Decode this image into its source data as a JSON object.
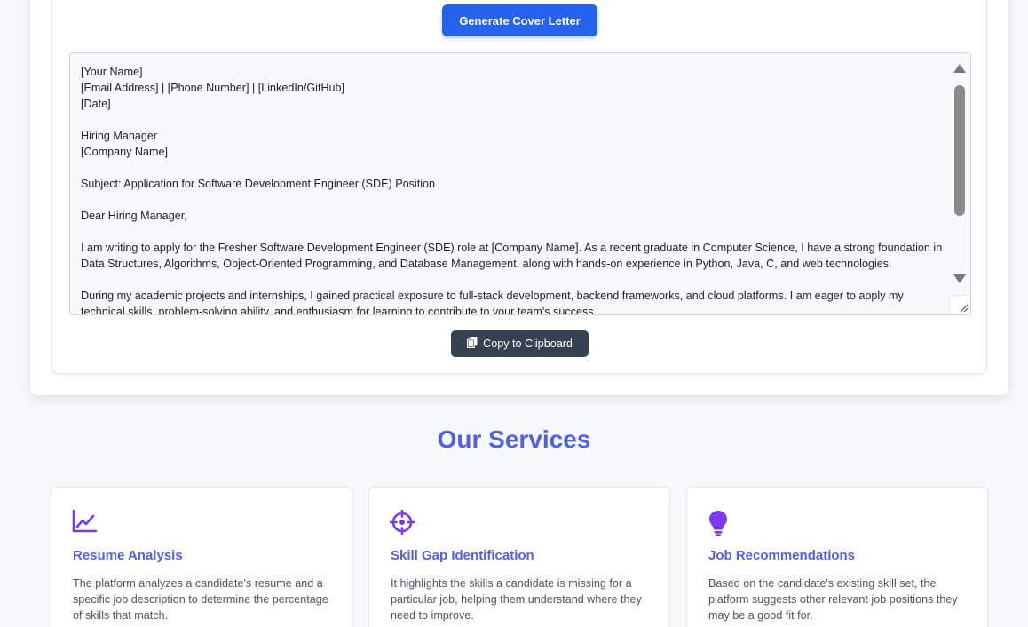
{
  "generator": {
    "generate_label": "Generate Cover Letter",
    "copy_label": "Copy to Clipboard",
    "letter_text": "[Your Name]\n[Email Address] | [Phone Number] | [LinkedIn/GitHub]\n[Date]\n\nHiring Manager\n[Company Name]\n\nSubject: Application for Software Development Engineer (SDE) Position\n\nDear Hiring Manager,\n\nI am writing to apply for the Fresher Software Development Engineer (SDE) role at [Company Name]. As a recent graduate in Computer Science, I have a strong foundation in Data Structures, Algorithms, Object-Oriented Programming, and Database Management, along with hands-on experience in Python, Java, C, and web technologies.\n\nDuring my academic projects and internships, I gained practical exposure to full-stack development, backend frameworks, and cloud platforms. I am eager to apply my technical skills, problem-solving ability, and enthusiasm for learning to contribute to your team's success."
  },
  "services": {
    "title": "Our Services",
    "cards": [
      {
        "icon": "chart-line-icon",
        "title": "Resume Analysis",
        "description": "The platform analyzes a candidate's resume and a specific job description to determine the percentage of skills that match."
      },
      {
        "icon": "crosshairs-icon",
        "title": "Skill Gap Identification",
        "description": "It highlights the skills a candidate is missing for a particular job, helping them understand where they need to improve."
      },
      {
        "icon": "lightbulb-icon",
        "title": "Job Recommendations",
        "description": "Based on the candidate's existing skill set, the platform suggests other relevant job positions they may be a good fit for."
      }
    ]
  },
  "colors": {
    "primary_button": "#2563eb",
    "secondary_button": "#374151",
    "accent_title": "#5160e8",
    "icon_purple": "#7c3aed"
  }
}
